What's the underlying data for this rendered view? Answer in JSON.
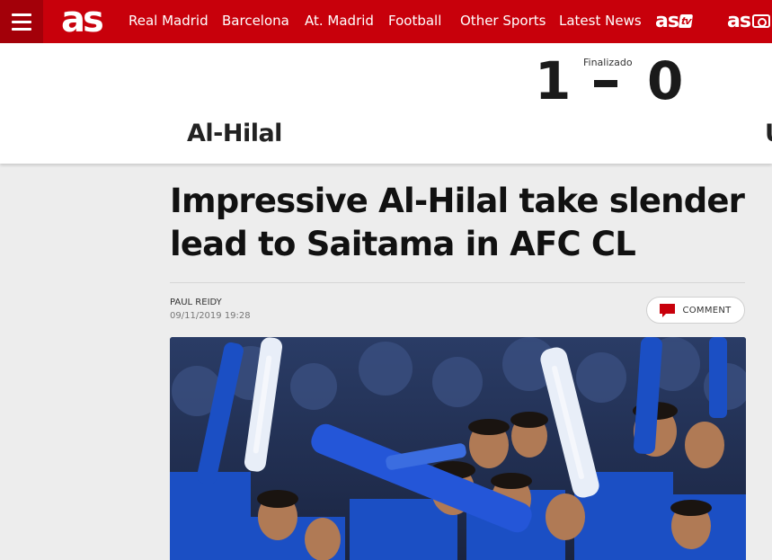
{
  "nav": {
    "logo": "as",
    "items": [
      "Real Madrid",
      "Barcelona",
      "At. Madrid",
      "Football",
      "Other Sports",
      "Latest News"
    ],
    "astv_label": "as",
    "astv_badge": "tv",
    "asfoto_label": "as"
  },
  "match": {
    "status": "Finalizado",
    "home_score": "1",
    "away_score": "0",
    "home_team": "Al-Hilal",
    "away_team_partial": "U"
  },
  "article": {
    "headline": "Impressive Al-Hilal take slender lead to Saitama in AFC CL",
    "author": "PAUL REIDY",
    "date": "09/11/2019 19:28",
    "comment_label": "COMMENT"
  },
  "colors": {
    "brand_red": "#c8000b",
    "hilal_blue": "#1b4fc4"
  }
}
